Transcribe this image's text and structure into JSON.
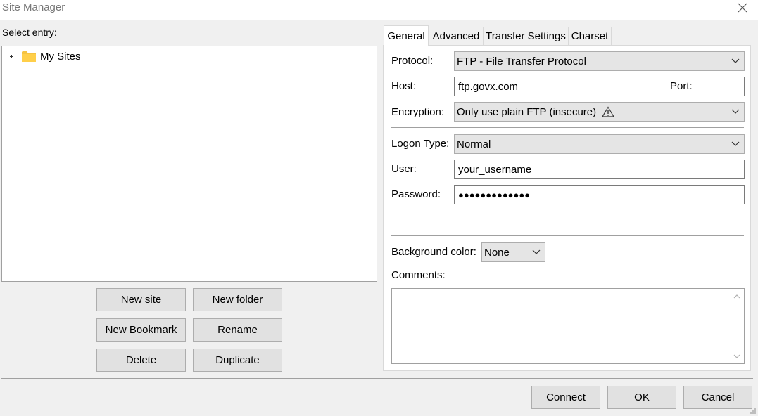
{
  "window": {
    "title": "Site Manager"
  },
  "left": {
    "select_entry_label": "Select entry:",
    "tree": [
      {
        "label": "My Sites",
        "icon": "folder-icon"
      }
    ],
    "buttons": {
      "new_site": "New site",
      "new_folder": "New folder",
      "new_bookmark": "New Bookmark",
      "rename": "Rename",
      "delete": "Delete",
      "duplicate": "Duplicate"
    }
  },
  "tabs": [
    {
      "label": "General",
      "active": true
    },
    {
      "label": "Advanced",
      "active": false
    },
    {
      "label": "Transfer Settings",
      "active": false
    },
    {
      "label": "Charset",
      "active": false
    }
  ],
  "general": {
    "protocol_label": "Protocol:",
    "protocol_value": "FTP - File Transfer Protocol",
    "host_label": "Host:",
    "host_value": "ftp.govx.com",
    "port_label": "Port:",
    "port_value": "",
    "encryption_label": "Encryption:",
    "encryption_value": "Only use plain FTP (insecure)",
    "logon_type_label": "Logon Type:",
    "logon_type_value": "Normal",
    "user_label": "User:",
    "user_value": "your_username",
    "password_label": "Password:",
    "password_value": "●●●●●●●●●●●●●",
    "background_color_label": "Background color:",
    "background_color_value": "None",
    "comments_label": "Comments:",
    "comments_value": ""
  },
  "footer": {
    "connect": "Connect",
    "ok": "OK",
    "cancel": "Cancel"
  },
  "colors": {
    "folder": "#f5c342",
    "warning_icon": "#333333"
  }
}
